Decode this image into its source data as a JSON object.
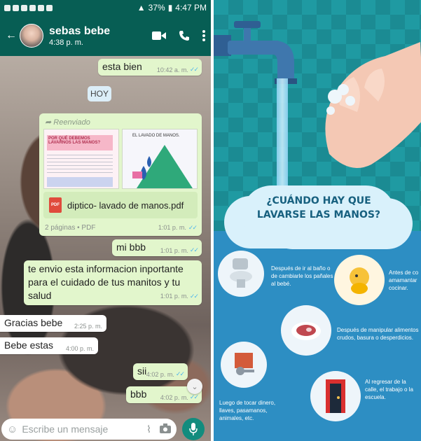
{
  "statusbar": {
    "battery": "37%",
    "time": "4:47 PM"
  },
  "header": {
    "name": "sebas bebe",
    "last_seen": "4:38 p. m."
  },
  "messages": {
    "m1": {
      "text": "esta bien",
      "time": "10:42 a. m."
    },
    "date_chip": "HOY",
    "forward": {
      "label": "Reenviado",
      "thumb1_title": "POR QUÉ DEBEMOS LAVARNOS LAS MANOS?",
      "thumb2_title": "EL LAVADO DE MANOS.",
      "file_name": "diptico- lavado de manos.pdf",
      "file_meta": "2 páginas • PDF",
      "time": "1:01 p. m."
    },
    "m2": {
      "text": "mi bbb",
      "time": "1:01 p. m."
    },
    "m3": {
      "text": "te  envio esta informacion inportante para el cuidado de tus manitos  y tu salud",
      "time": "1:01 p. m."
    },
    "m4": {
      "text": "Gracias bebe",
      "time": "2:25 p. m."
    },
    "m5": {
      "text": "Bebe estas",
      "time": "4:00 p. m."
    },
    "m6": {
      "text": "sii",
      "time": "4:02 p. m."
    },
    "m7": {
      "text": "bbb",
      "time": "4:02 p. m."
    }
  },
  "composer": {
    "placeholder": "Escribe un mensaje"
  },
  "poster": {
    "headline": "¿CUÁNDO HAY QUE LAVARSE LAS MANOS?",
    "items": {
      "toilet": "Después de ir al baño o de cambiarle los pañales al bebé.",
      "cooking": "Antes de co amamantar cocinar.",
      "food": "Después de manipular alimentos crudos, basura o desperdicios.",
      "money": "Luego de tocar dinero, llaves, pasamanos, animales, etc.",
      "door": "Al regresar de la calle, el trabajo o la escuela."
    }
  },
  "colors": {
    "header": "#075e54",
    "outgoing": "#e2f6cc",
    "accent": "#128c7e",
    "poster_bg": "#1b8b93"
  },
  "icons": [
    "video-call-icon",
    "phone-icon",
    "more-vert-icon",
    "emoji-icon",
    "attach-icon",
    "camera-icon",
    "mic-icon",
    "forward-icon",
    "pdf-icon",
    "double-check-icon"
  ]
}
